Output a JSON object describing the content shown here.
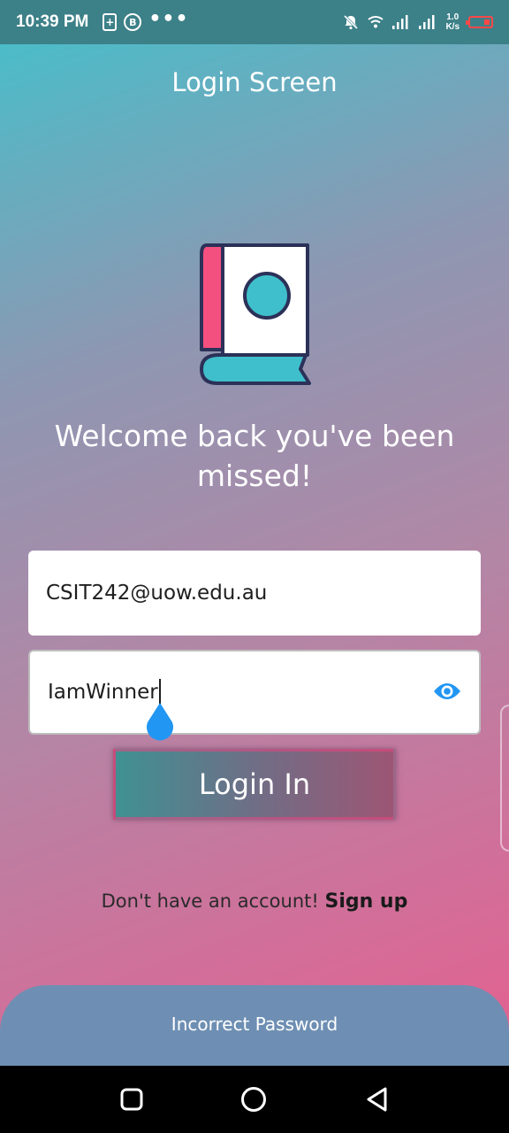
{
  "status_bar": {
    "time": "10:39 PM",
    "icon_box_label": "+",
    "icon_circle_label": "B",
    "more_dots": "•••",
    "data_rate_top": "1.0",
    "data_rate_bottom": "K/s",
    "icons": [
      "charging-icon",
      "b-app-icon",
      "more-dots-icon",
      "mute-bell-icon",
      "wifi-icon",
      "signal-icon",
      "signal-icon",
      "data-rate",
      "battery-icon"
    ],
    "battery_color": "#ff4848",
    "bar_color": "#3c8088"
  },
  "header": {
    "title": "Login Screen"
  },
  "logo": {
    "icon": "book-icon",
    "colors": {
      "cover": "#f4507f",
      "page": "#ffffff",
      "circle": "#3fbfcb",
      "base": "#3fbfcb",
      "outline": "#2b3158"
    }
  },
  "welcome": {
    "line1": "Welcome back you've been",
    "line2": "missed!"
  },
  "form": {
    "email_value": "CSIT242@uow.edu.au",
    "password_value": "IamWinner",
    "eye_icon": "visibility-icon",
    "eye_icon_color": "#2196f3"
  },
  "login_button": {
    "label": "Login In"
  },
  "signup": {
    "prompt": "Don't have an account! ",
    "link": "Sign up"
  },
  "snackbar": {
    "message": "Incorrect Password",
    "background": "#6e8fb3"
  },
  "nav_bar": {
    "buttons": [
      "recent-apps-icon",
      "home-icon",
      "back-icon"
    ]
  }
}
